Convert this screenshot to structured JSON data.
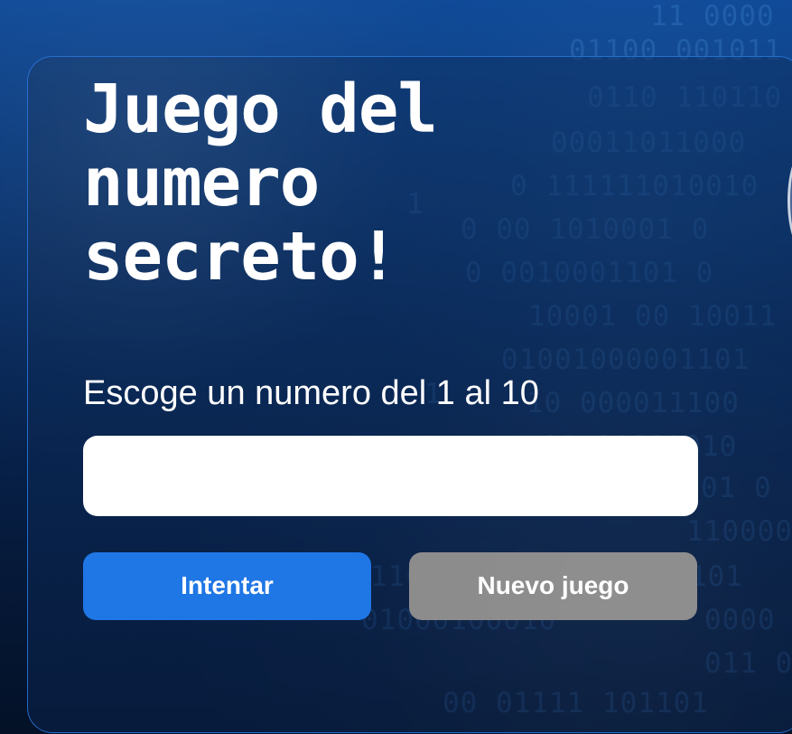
{
  "page": {
    "title": "Juego del numero secreto!",
    "prompt": "Escoge un numero del 1 al 10",
    "input": {
      "value": "",
      "placeholder": ""
    },
    "buttons": {
      "try": "Intentar",
      "new_game": "Nuevo juego"
    }
  },
  "colors": {
    "accent": "#1f76e5",
    "secondary": "#8b8b8b",
    "text": "#ffffff"
  }
}
